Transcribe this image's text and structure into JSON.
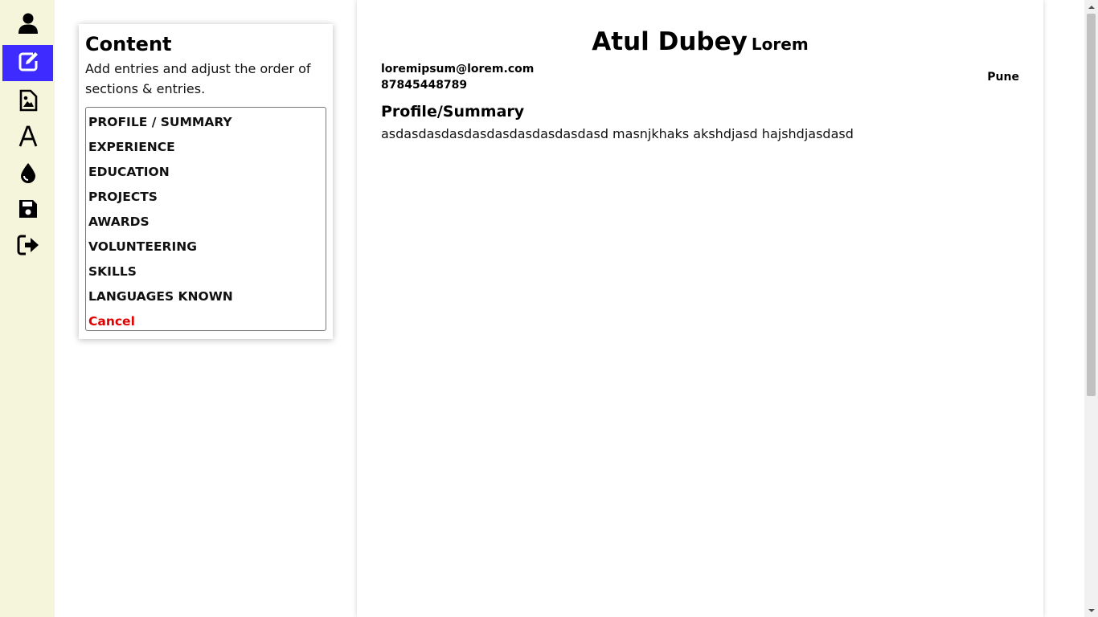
{
  "sidebar": {
    "items": [
      {
        "icon": "user-icon"
      },
      {
        "icon": "edit-icon",
        "active": true
      },
      {
        "icon": "image-file-icon"
      },
      {
        "icon": "font-icon"
      },
      {
        "icon": "color-drop-icon"
      },
      {
        "icon": "save-icon"
      },
      {
        "icon": "sign-out-icon"
      }
    ],
    "accent": "#3d2bff",
    "background": "#f5f5dc"
  },
  "panel": {
    "title": "Content",
    "description": "Add entries and adjust the order of sections & entries.",
    "items": [
      {
        "label": "PROFILE / SUMMARY"
      },
      {
        "label": "EXPERIENCE"
      },
      {
        "label": "EDUCATION"
      },
      {
        "label": "PROJECTS"
      },
      {
        "label": "AWARDS"
      },
      {
        "label": "VOLUNTEERING"
      },
      {
        "label": "SKILLS"
      },
      {
        "label": "LANGUAGES KNOWN"
      }
    ],
    "cancel_label": "Cancel",
    "cancel_color": "#e00000"
  },
  "resume": {
    "name": "Atul Dubey",
    "subtitle": "Lorem",
    "email": "loremipsum@lorem.com",
    "phone": "87845448789",
    "city": "Pune",
    "sections": [
      {
        "title": "Profile/Summary",
        "text": "asdasdasdasdasdasdasdasdasdasd masnjkhaks akshdjasd hajshdjasdasd"
      }
    ]
  }
}
